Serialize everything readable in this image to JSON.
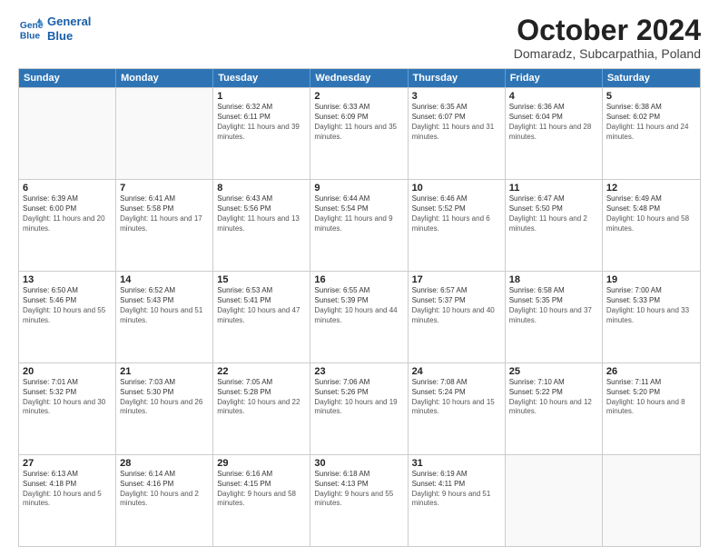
{
  "header": {
    "logo_line1": "General",
    "logo_line2": "Blue",
    "title": "October 2024",
    "subtitle": "Domaradz, Subcarpathia, Poland"
  },
  "weekdays": [
    "Sunday",
    "Monday",
    "Tuesday",
    "Wednesday",
    "Thursday",
    "Friday",
    "Saturday"
  ],
  "weeks": [
    [
      {
        "day": "",
        "sunrise": "",
        "sunset": "",
        "daylight": ""
      },
      {
        "day": "",
        "sunrise": "",
        "sunset": "",
        "daylight": ""
      },
      {
        "day": "1",
        "sunrise": "Sunrise: 6:32 AM",
        "sunset": "Sunset: 6:11 PM",
        "daylight": "Daylight: 11 hours and 39 minutes."
      },
      {
        "day": "2",
        "sunrise": "Sunrise: 6:33 AM",
        "sunset": "Sunset: 6:09 PM",
        "daylight": "Daylight: 11 hours and 35 minutes."
      },
      {
        "day": "3",
        "sunrise": "Sunrise: 6:35 AM",
        "sunset": "Sunset: 6:07 PM",
        "daylight": "Daylight: 11 hours and 31 minutes."
      },
      {
        "day": "4",
        "sunrise": "Sunrise: 6:36 AM",
        "sunset": "Sunset: 6:04 PM",
        "daylight": "Daylight: 11 hours and 28 minutes."
      },
      {
        "day": "5",
        "sunrise": "Sunrise: 6:38 AM",
        "sunset": "Sunset: 6:02 PM",
        "daylight": "Daylight: 11 hours and 24 minutes."
      }
    ],
    [
      {
        "day": "6",
        "sunrise": "Sunrise: 6:39 AM",
        "sunset": "Sunset: 6:00 PM",
        "daylight": "Daylight: 11 hours and 20 minutes."
      },
      {
        "day": "7",
        "sunrise": "Sunrise: 6:41 AM",
        "sunset": "Sunset: 5:58 PM",
        "daylight": "Daylight: 11 hours and 17 minutes."
      },
      {
        "day": "8",
        "sunrise": "Sunrise: 6:43 AM",
        "sunset": "Sunset: 5:56 PM",
        "daylight": "Daylight: 11 hours and 13 minutes."
      },
      {
        "day": "9",
        "sunrise": "Sunrise: 6:44 AM",
        "sunset": "Sunset: 5:54 PM",
        "daylight": "Daylight: 11 hours and 9 minutes."
      },
      {
        "day": "10",
        "sunrise": "Sunrise: 6:46 AM",
        "sunset": "Sunset: 5:52 PM",
        "daylight": "Daylight: 11 hours and 6 minutes."
      },
      {
        "day": "11",
        "sunrise": "Sunrise: 6:47 AM",
        "sunset": "Sunset: 5:50 PM",
        "daylight": "Daylight: 11 hours and 2 minutes."
      },
      {
        "day": "12",
        "sunrise": "Sunrise: 6:49 AM",
        "sunset": "Sunset: 5:48 PM",
        "daylight": "Daylight: 10 hours and 58 minutes."
      }
    ],
    [
      {
        "day": "13",
        "sunrise": "Sunrise: 6:50 AM",
        "sunset": "Sunset: 5:46 PM",
        "daylight": "Daylight: 10 hours and 55 minutes."
      },
      {
        "day": "14",
        "sunrise": "Sunrise: 6:52 AM",
        "sunset": "Sunset: 5:43 PM",
        "daylight": "Daylight: 10 hours and 51 minutes."
      },
      {
        "day": "15",
        "sunrise": "Sunrise: 6:53 AM",
        "sunset": "Sunset: 5:41 PM",
        "daylight": "Daylight: 10 hours and 47 minutes."
      },
      {
        "day": "16",
        "sunrise": "Sunrise: 6:55 AM",
        "sunset": "Sunset: 5:39 PM",
        "daylight": "Daylight: 10 hours and 44 minutes."
      },
      {
        "day": "17",
        "sunrise": "Sunrise: 6:57 AM",
        "sunset": "Sunset: 5:37 PM",
        "daylight": "Daylight: 10 hours and 40 minutes."
      },
      {
        "day": "18",
        "sunrise": "Sunrise: 6:58 AM",
        "sunset": "Sunset: 5:35 PM",
        "daylight": "Daylight: 10 hours and 37 minutes."
      },
      {
        "day": "19",
        "sunrise": "Sunrise: 7:00 AM",
        "sunset": "Sunset: 5:33 PM",
        "daylight": "Daylight: 10 hours and 33 minutes."
      }
    ],
    [
      {
        "day": "20",
        "sunrise": "Sunrise: 7:01 AM",
        "sunset": "Sunset: 5:32 PM",
        "daylight": "Daylight: 10 hours and 30 minutes."
      },
      {
        "day": "21",
        "sunrise": "Sunrise: 7:03 AM",
        "sunset": "Sunset: 5:30 PM",
        "daylight": "Daylight: 10 hours and 26 minutes."
      },
      {
        "day": "22",
        "sunrise": "Sunrise: 7:05 AM",
        "sunset": "Sunset: 5:28 PM",
        "daylight": "Daylight: 10 hours and 22 minutes."
      },
      {
        "day": "23",
        "sunrise": "Sunrise: 7:06 AM",
        "sunset": "Sunset: 5:26 PM",
        "daylight": "Daylight: 10 hours and 19 minutes."
      },
      {
        "day": "24",
        "sunrise": "Sunrise: 7:08 AM",
        "sunset": "Sunset: 5:24 PM",
        "daylight": "Daylight: 10 hours and 15 minutes."
      },
      {
        "day": "25",
        "sunrise": "Sunrise: 7:10 AM",
        "sunset": "Sunset: 5:22 PM",
        "daylight": "Daylight: 10 hours and 12 minutes."
      },
      {
        "day": "26",
        "sunrise": "Sunrise: 7:11 AM",
        "sunset": "Sunset: 5:20 PM",
        "daylight": "Daylight: 10 hours and 8 minutes."
      }
    ],
    [
      {
        "day": "27",
        "sunrise": "Sunrise: 6:13 AM",
        "sunset": "Sunset: 4:18 PM",
        "daylight": "Daylight: 10 hours and 5 minutes."
      },
      {
        "day": "28",
        "sunrise": "Sunrise: 6:14 AM",
        "sunset": "Sunset: 4:16 PM",
        "daylight": "Daylight: 10 hours and 2 minutes."
      },
      {
        "day": "29",
        "sunrise": "Sunrise: 6:16 AM",
        "sunset": "Sunset: 4:15 PM",
        "daylight": "Daylight: 9 hours and 58 minutes."
      },
      {
        "day": "30",
        "sunrise": "Sunrise: 6:18 AM",
        "sunset": "Sunset: 4:13 PM",
        "daylight": "Daylight: 9 hours and 55 minutes."
      },
      {
        "day": "31",
        "sunrise": "Sunrise: 6:19 AM",
        "sunset": "Sunset: 4:11 PM",
        "daylight": "Daylight: 9 hours and 51 minutes."
      },
      {
        "day": "",
        "sunrise": "",
        "sunset": "",
        "daylight": ""
      },
      {
        "day": "",
        "sunrise": "",
        "sunset": "",
        "daylight": ""
      }
    ]
  ]
}
